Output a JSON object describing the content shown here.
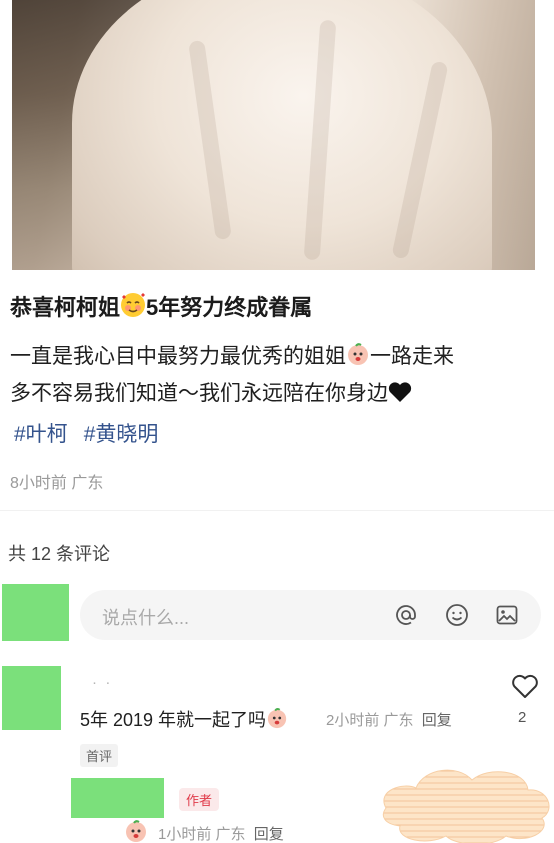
{
  "post": {
    "title_part1": "恭喜柯柯姐",
    "title_part2": "5年努力终成眷属",
    "body_line1_a": "一直是我心目中最努力最优秀的姐姐",
    "body_line1_b": "一路走来",
    "body_line2": "多不容易我们知道～我们永远陪在你身边",
    "tags": [
      "#叶柯",
      "#黄晓明"
    ],
    "meta": "8小时前 广东"
  },
  "comments_section": {
    "count_label": "共 12 条评论",
    "input_placeholder": "说点什么..."
  },
  "icons": {
    "at": "at-icon",
    "emoji": "smiley-icon",
    "image": "image-icon",
    "like": "heart-icon"
  },
  "comments": [
    {
      "text": "5年 2019 年就一起了吗",
      "time": "2小时前 广东",
      "reply_label": "回复",
      "likes": "2",
      "badge": "首评"
    },
    {
      "author_badge": "作者",
      "time": "1小时前 广东",
      "reply_label": "回复"
    }
  ],
  "colors": {
    "tag": "#34538d",
    "author_badge": "#e03b4a",
    "redaction": "#7be07b"
  }
}
